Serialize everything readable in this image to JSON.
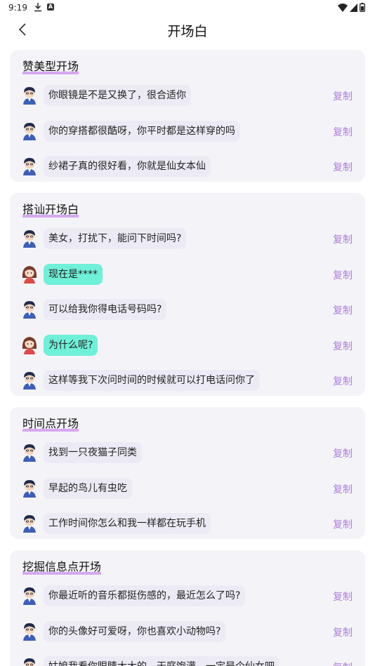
{
  "status_bar": {
    "time": "9:19",
    "a_icon_letter": "A"
  },
  "header": {
    "title": "开场白"
  },
  "copy_label": "复制",
  "colors": {
    "accent": "#b07de0",
    "highlight": "#d7a7f2",
    "girl_bubble": "#6ff0d8",
    "card_bg": "#f4f4f8"
  },
  "sections": [
    {
      "title": "赞美型开场",
      "items": [
        {
          "speaker": "boy",
          "text": "你眼镜是不是又换了，很合适你"
        },
        {
          "speaker": "boy",
          "text": "你的穿搭都很酷呀，你平时都是这样穿的吗"
        },
        {
          "speaker": "boy",
          "text": "纱裙子真的很好看，你就是仙女本仙"
        }
      ]
    },
    {
      "title": "搭讪开场白",
      "items": [
        {
          "speaker": "boy",
          "text": "美女，打扰下，能问下时间吗?"
        },
        {
          "speaker": "girl",
          "text": "现在是****"
        },
        {
          "speaker": "boy",
          "text": "可以给我你得电话号码吗?"
        },
        {
          "speaker": "girl",
          "text": "为什么呢?"
        },
        {
          "speaker": "boy",
          "text": "这样等我下次问时间的时候就可以打电话问你了"
        }
      ]
    },
    {
      "title": "时间点开场",
      "items": [
        {
          "speaker": "boy",
          "text": "找到一只夜猫子同类"
        },
        {
          "speaker": "boy",
          "text": "早起的鸟儿有虫吃"
        },
        {
          "speaker": "boy",
          "text": "工作时间你怎么和我一样都在玩手机"
        }
      ]
    },
    {
      "title": "挖掘信息点开场",
      "items": [
        {
          "speaker": "boy",
          "text": "你最近听的音乐都挺伤感的，最近怎么了吗?"
        },
        {
          "speaker": "boy",
          "text": "你的头像好可爱呀，你也喜欢小动物吗?"
        },
        {
          "speaker": "boy",
          "text": "姑娘我看你眼睛大大的，天庭饱满，一定是个仙女吧"
        }
      ]
    }
  ]
}
